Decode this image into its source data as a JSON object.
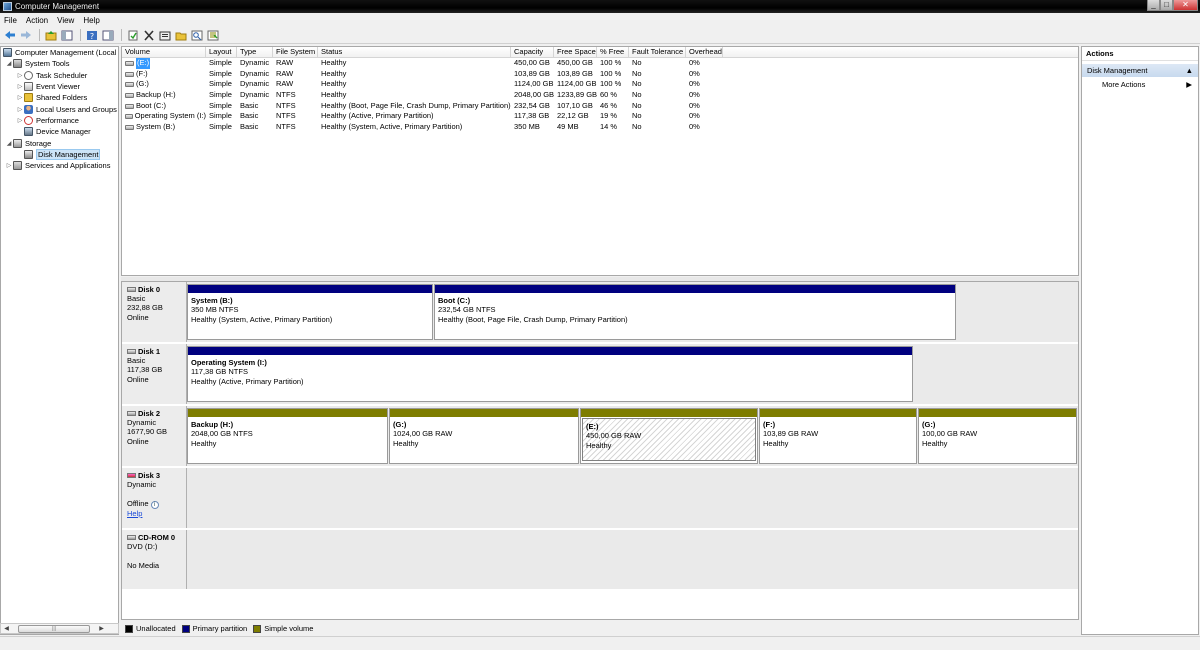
{
  "window": {
    "title": "Computer Management",
    "min": "_",
    "max": "□",
    "close": "✕"
  },
  "menu": [
    {
      "label": "File"
    },
    {
      "label": "Action"
    },
    {
      "label": "View"
    },
    {
      "label": "Help"
    }
  ],
  "toolbar_icons": [
    "back-arrow-icon",
    "forward-arrow-icon",
    "up-folder-icon",
    "show-hide-tree-icon",
    "help-icon",
    "show-action-pane-icon",
    "refresh-icon",
    "delete-icon",
    "properties-icon",
    "open-folder-icon",
    "search-icon",
    "export-icon"
  ],
  "tree": [
    {
      "label": "Computer Management (Local",
      "level": 0,
      "exp": "",
      "icon": "computer-icon"
    },
    {
      "label": "System Tools",
      "level": 1,
      "exp": "◢",
      "icon": "tools-icon"
    },
    {
      "label": "Task Scheduler",
      "level": 2,
      "exp": "▷",
      "icon": "clock-icon"
    },
    {
      "label": "Event Viewer",
      "level": 2,
      "exp": "▷",
      "icon": "event-viewer-icon"
    },
    {
      "label": "Shared Folders",
      "level": 2,
      "exp": "▷",
      "icon": "shared-folder-icon"
    },
    {
      "label": "Local Users and Groups",
      "level": 2,
      "exp": "▷",
      "icon": "users-icon"
    },
    {
      "label": "Performance",
      "level": 2,
      "exp": "▷",
      "icon": "performance-icon"
    },
    {
      "label": "Device Manager",
      "level": 2,
      "exp": "",
      "icon": "device-manager-icon"
    },
    {
      "label": "Storage",
      "level": 1,
      "exp": "◢",
      "icon": "storage-icon"
    },
    {
      "label": "Disk Management",
      "level": 2,
      "exp": "",
      "icon": "disk-management-icon",
      "selected": true
    },
    {
      "label": "Services and Applications",
      "level": 1,
      "exp": "▷",
      "icon": "services-icon"
    }
  ],
  "volume_columns": [
    "Volume",
    "Layout",
    "Type",
    "File System",
    "Status",
    "Capacity",
    "Free Space",
    "% Free",
    "Fault Tolerance",
    "Overhead"
  ],
  "volumes": [
    [
      "(E:)",
      "Simple",
      "Dynamic",
      "RAW",
      "Healthy",
      "450,00 GB",
      "450,00 GB",
      "100 %",
      "No",
      "0%"
    ],
    [
      "(F:)",
      "Simple",
      "Dynamic",
      "RAW",
      "Healthy",
      "103,89 GB",
      "103,89 GB",
      "100 %",
      "No",
      "0%"
    ],
    [
      "(G:)",
      "Simple",
      "Dynamic",
      "RAW",
      "Healthy",
      "1124,00 GB",
      "1124,00 GB",
      "100 %",
      "No",
      "0%"
    ],
    [
      "Backup (H:)",
      "Simple",
      "Dynamic",
      "NTFS",
      "Healthy",
      "2048,00 GB",
      "1233,89 GB",
      "60 %",
      "No",
      "0%"
    ],
    [
      "Boot (C:)",
      "Simple",
      "Basic",
      "NTFS",
      "Healthy (Boot, Page File, Crash Dump, Primary Partition)",
      "232,54 GB",
      "107,10 GB",
      "46 %",
      "No",
      "0%"
    ],
    [
      "Operating System (I:)",
      "Simple",
      "Basic",
      "NTFS",
      "Healthy (Active, Primary Partition)",
      "117,38 GB",
      "22,12 GB",
      "19 %",
      "No",
      "0%"
    ],
    [
      "System (B:)",
      "Simple",
      "Basic",
      "NTFS",
      "Healthy (System, Active, Primary Partition)",
      "350 MB",
      "49 MB",
      "14 %",
      "No",
      "0%"
    ]
  ],
  "disks": [
    {
      "name": "Disk 0",
      "lines": [
        "Basic",
        "232,88 GB",
        "Online"
      ],
      "partitions": [
        {
          "name": "System  (B:)",
          "size": "350 MB NTFS",
          "status": "Healthy (System, Active, Primary Partition)",
          "kind": "primary"
        },
        {
          "name": "Boot  (C:)",
          "size": "232,54 GB NTFS",
          "status": "Healthy (Boot, Page File, Crash Dump, Primary Partition)",
          "kind": "primary"
        }
      ]
    },
    {
      "name": "Disk 1",
      "lines": [
        "Basic",
        "117,38 GB",
        "Online"
      ],
      "partitions": [
        {
          "name": "Operating System  (I:)",
          "size": "117,38 GB NTFS",
          "status": "Healthy (Active, Primary Partition)",
          "kind": "primary"
        }
      ]
    },
    {
      "name": "Disk 2",
      "lines": [
        "Dynamic",
        "1677,90 GB",
        "Online"
      ],
      "partitions": [
        {
          "name": "Backup  (H:)",
          "size": "2048,00 GB NTFS",
          "status": "Healthy",
          "kind": "simple"
        },
        {
          "name": "(G:)",
          "size": "1024,00 GB RAW",
          "status": "Healthy",
          "kind": "simple"
        },
        {
          "name": "(E:)",
          "size": "450,00 GB RAW",
          "status": "Healthy",
          "kind": "simple",
          "hatched": true
        },
        {
          "name": "(F:)",
          "size": "103,89 GB RAW",
          "status": "Healthy",
          "kind": "simple"
        },
        {
          "name": "(G:)",
          "size": "100,00 GB RAW",
          "status": "Healthy",
          "kind": "simple"
        }
      ]
    },
    {
      "name": "Disk 3",
      "lines": [
        "Dynamic",
        "",
        "Offline"
      ],
      "help": "Help",
      "offline": true,
      "partitions": []
    },
    {
      "name": "CD-ROM 0",
      "lines": [
        "DVD (D:)",
        "",
        "No Media"
      ],
      "partitions": []
    }
  ],
  "legend": [
    {
      "label": "Unallocated",
      "color": "#000000"
    },
    {
      "label": "Primary partition",
      "color": "#00007f"
    },
    {
      "label": "Simple volume",
      "color": "#7e7d00"
    }
  ],
  "actions": {
    "header": "Actions",
    "section": "Disk Management",
    "items": [
      "More Actions"
    ]
  }
}
